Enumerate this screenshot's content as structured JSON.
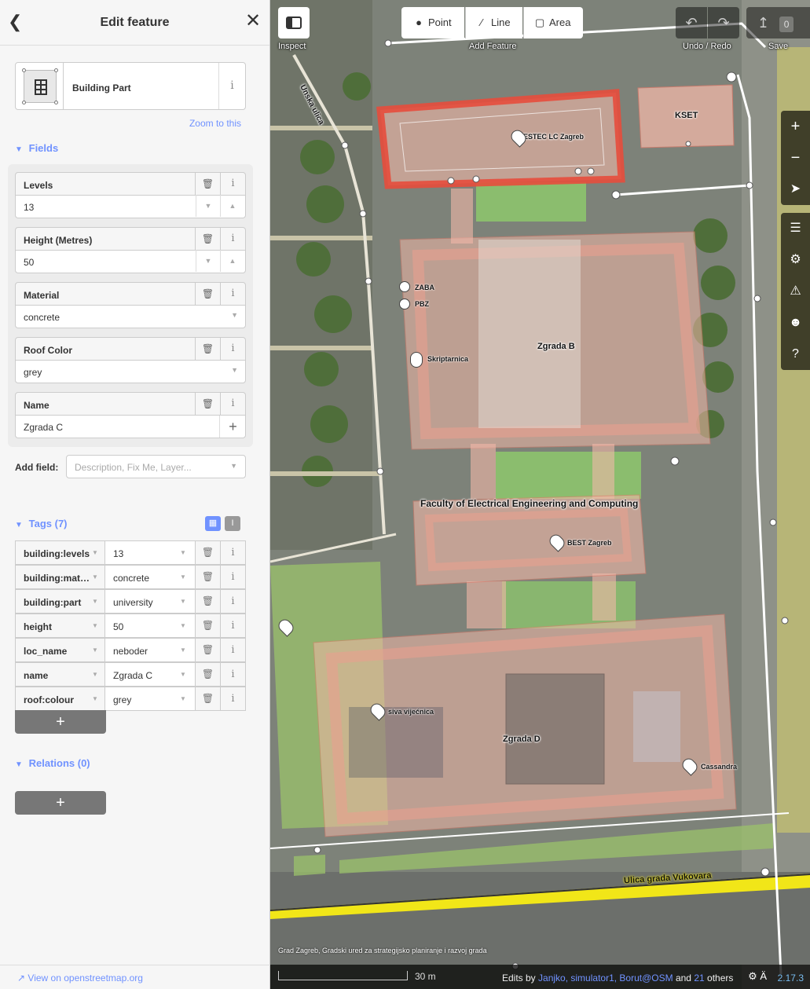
{
  "sidebar": {
    "header_title": "Edit feature",
    "preset": {
      "name": "Building Part"
    },
    "zoom_to_this": "Zoom to this",
    "fields_title": "Fields",
    "fields": [
      {
        "label": "Levels",
        "value": "13"
      },
      {
        "label": "Height (Metres)",
        "value": "50"
      },
      {
        "label": "Material",
        "value": "concrete"
      },
      {
        "label": "Roof Color",
        "value": "grey"
      },
      {
        "label": "Name",
        "value": "Zgrada C"
      }
    ],
    "add_field_label": "Add field:",
    "add_field_placeholder": "Description, Fix Me, Layer...",
    "tags_title": "Tags (7)",
    "tags": [
      {
        "key": "building:levels",
        "value": "13"
      },
      {
        "key": "building:mat…",
        "value": "concrete"
      },
      {
        "key": "building:part",
        "value": "university"
      },
      {
        "key": "height",
        "value": "50"
      },
      {
        "key": "loc_name",
        "value": "neboder"
      },
      {
        "key": "name",
        "value": "Zgrada C"
      },
      {
        "key": "roof:colour",
        "value": "grey"
      }
    ],
    "add_label": "+",
    "relations_title": "Relations (0)",
    "view_on_osm": "View on openstreetmap.org"
  },
  "toolbar": {
    "inspect_label": "Inspect",
    "add_feature_label": "Add Feature",
    "modes": {
      "point": "Point",
      "line": "Line",
      "area": "Area"
    },
    "undo_redo_label": "Undo / Redo",
    "save_label": "Save",
    "save_count": "0"
  },
  "map": {
    "labels": {
      "eestec": "EESTEC LC Zagreb",
      "kset": "KSET",
      "zaba": "ZABA",
      "pbz": "PBZ",
      "skriptarnica": "Skriptarnica",
      "zgrada_b": "Zgrada B",
      "faculty": "Faculty of Electrical Engineering and Computing",
      "best": "BEST Zagreb",
      "siva": "siva vijećnica",
      "zgrada_d": "Zgrada D",
      "cassandra": "Cassandra",
      "unska": "Unska ulica",
      "vukovara": "Ulica grada Vukovara"
    },
    "attribution": "Grad Zagreb, Gradski ured za strategijsko planiranje i razvoj grada",
    "scale_label": "30 m",
    "edits_prefix": "Edits by",
    "edits_users": "Janjko, simulator1, Borut@OSM",
    "edits_and": "and",
    "edits_count": "21",
    "edits_suffix": "others",
    "version": "2.17.3"
  },
  "colors": {
    "accent": "#7092ff",
    "selected_outline": "#e74c3c",
    "building_fill": "#f2b8a8",
    "road_yellow": "#f1e618"
  }
}
